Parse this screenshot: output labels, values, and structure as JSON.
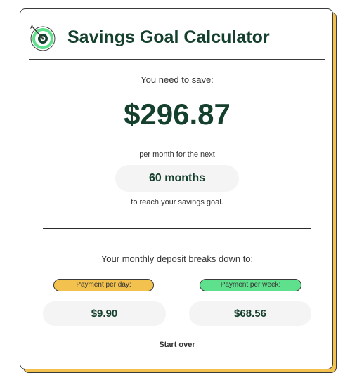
{
  "header": {
    "title": "Savings Goal Calculator",
    "icon": "target-arrow-icon"
  },
  "result": {
    "need_label": "You need to save:",
    "amount": "$296.87",
    "per_month_label": "per month for the next",
    "months": "60 months",
    "reach_goal_label": "to reach your savings goal."
  },
  "breakdown": {
    "label": "Your monthly deposit breaks down to:",
    "per_day_label": "Payment per day:",
    "per_day_value": "$9.90",
    "per_week_label": "Payment per week:",
    "per_week_value": "$68.56"
  },
  "actions": {
    "start_over": "Start over"
  },
  "colors": {
    "primary_dark_green": "#16402e",
    "accent_yellow": "#f2c14e",
    "accent_green": "#5ee08c",
    "pill_background": "#f4f4f4"
  }
}
